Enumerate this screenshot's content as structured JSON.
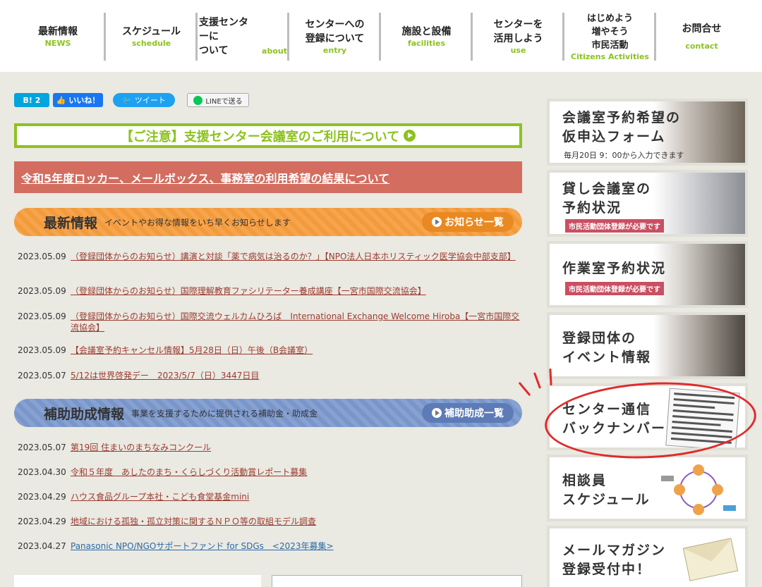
{
  "nav": [
    {
      "jp": "最新情報",
      "en": "NEWS"
    },
    {
      "jp": "スケジュール",
      "en": "schedule"
    },
    {
      "jp": "支援センターに\nついて",
      "en": "about"
    },
    {
      "jp": "センターへの\n登録について",
      "en": "entry"
    },
    {
      "jp": "施設と設備",
      "en": "facilities"
    },
    {
      "jp": "センターを\n活用しよう",
      "en": "use"
    },
    {
      "jp": "はじめよう\n増やそう\n市民活動",
      "en": "Citizens Activities"
    },
    {
      "jp": "お問合せ",
      "en": "contact"
    }
  ],
  "social": {
    "hatena": "B! 2",
    "facebook": "いいね！",
    "twitter": "ツイート",
    "line": "LINEで送る"
  },
  "notice": {
    "label": "【ご注意】支援センター会議室のご利用について"
  },
  "result_banner": {
    "label": "令和5年度ロッカー、メールボックス、事務室の利用希望の結果について"
  },
  "news": {
    "title": "最新情報",
    "description": "イベントやお得な情報をいち早くお知らせします",
    "more": "お知らせ一覧",
    "items": [
      {
        "date": "2023.05.09",
        "title": "（登録団体からのお知らせ）講演と対談「薬で病気は治るのか？」【NPO法人日本ホリスティック医学協会中部支部】"
      },
      {
        "date": "2023.05.09",
        "title": "（登録団体からのお知らせ）国際理解教育ファシリテーター養成講座【一宮市国際交流協会】"
      },
      {
        "date": "2023.05.09",
        "title": "（登録団体からのお知らせ）国際交流ウェルカムひろば　International Exchange Welcome Hiroba【一宮市国際交流協会】"
      },
      {
        "date": "2023.05.09",
        "title": "【会議室予約キャンセル情報】5月28日（日）午後（B会議室）"
      },
      {
        "date": "2023.05.07",
        "title": "5/12は世界啓発デー　2023/5/7（日）3447日目"
      }
    ]
  },
  "grants": {
    "title": "補助助成情報",
    "description": "事業を支援するために提供される補助金・助成金",
    "more": "補助助成一覧",
    "items": [
      {
        "date": "2023.05.07",
        "title": "第19回 住まいのまちなみコンクール"
      },
      {
        "date": "2023.04.30",
        "title": "令和５年度　あしたのまち・くらしづくり活動賞レポート募集"
      },
      {
        "date": "2023.04.29",
        "title": "ハウス食品グループ本社・こども食堂基金mini"
      },
      {
        "date": "2023.04.29",
        "title": "地域における孤独・孤立対策に関するＮＰＯ等の取組モデル調査"
      },
      {
        "date": "2023.04.27",
        "title": "Panasonic NPO/NGOサポートファンド for SDGs　<2023年募集>"
      }
    ]
  },
  "sidebar": [
    {
      "title": "会議室予約希望の\n仮申込フォーム",
      "sub": "毎月20日 9：00から入力できます"
    },
    {
      "title": "貸し会議室の\n予約状況",
      "tag": "市民活動団体登録が必要です"
    },
    {
      "title": "作業室予約状況",
      "tag": "市民活動団体登録が必要です"
    },
    {
      "title": "登録団体の\nイベント情報"
    },
    {
      "title": "センター通信\nバックナンバー"
    },
    {
      "title": "相談員\nスケジュール"
    },
    {
      "title": "メールマガジン\n登録受付中！"
    }
  ],
  "colors": {
    "accent_green": "#8dc21f",
    "orange": "#f39a3b",
    "blue": "#7a96c9",
    "banner_red": "#d36d5f",
    "annotation_red": "#e02a2a"
  }
}
